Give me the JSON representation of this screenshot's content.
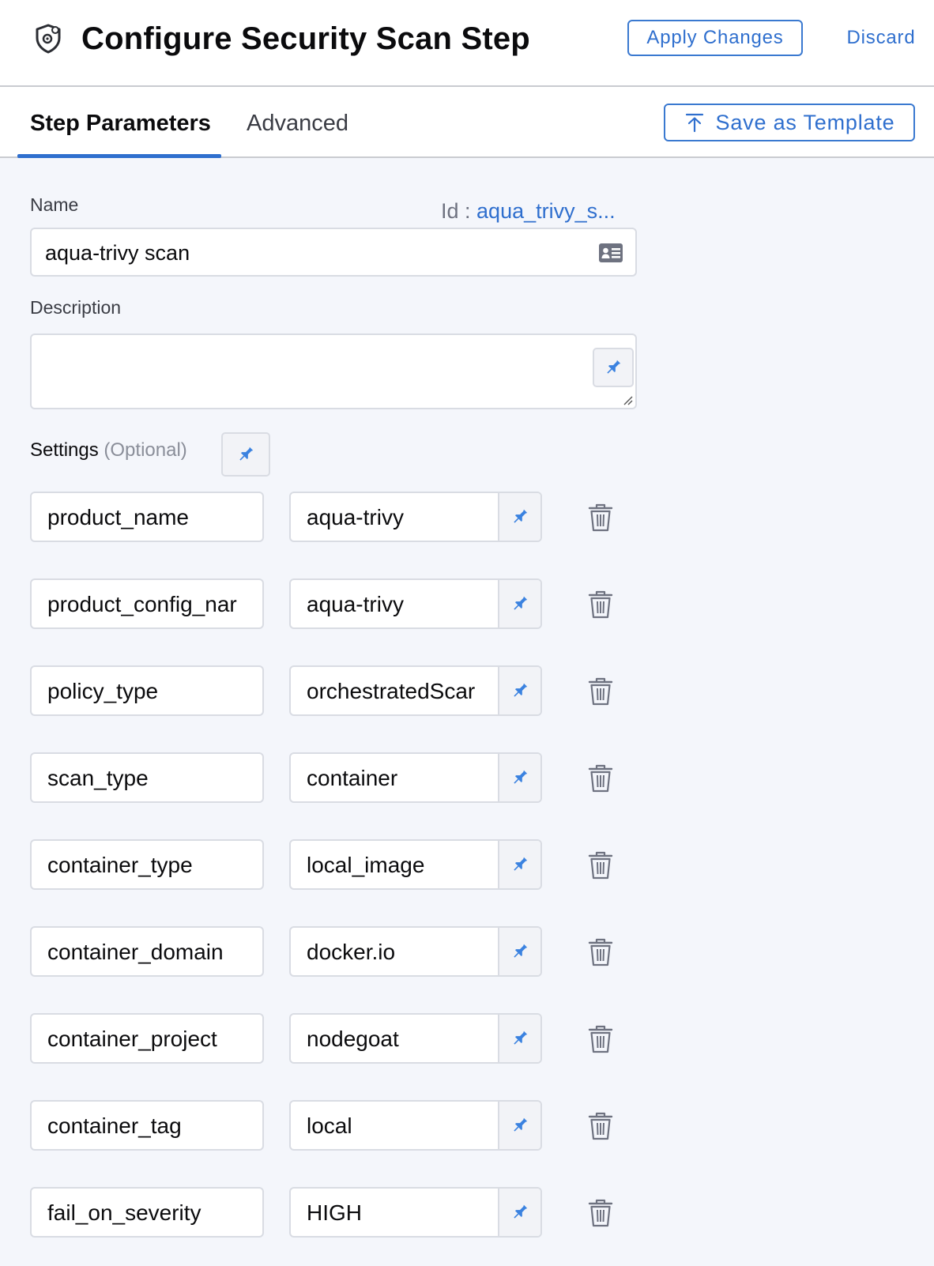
{
  "header": {
    "title": "Configure Security Scan Step",
    "icon": "shield-gear-icon",
    "apply_label": "Apply Changes",
    "discard_label": "Discard"
  },
  "tabs": [
    {
      "label": "Step Parameters",
      "active": true
    },
    {
      "label": "Advanced",
      "active": false
    }
  ],
  "save_template_label": "Save as Template",
  "form": {
    "name_label": "Name",
    "id_prefix": "Id : ",
    "id_value": "aqua_trivy_s...",
    "name_value": "aqua-trivy scan",
    "description_label": "Description",
    "description_value": "",
    "settings_label": "Settings",
    "settings_optional": "(Optional)"
  },
  "settings": [
    {
      "key": "product_name",
      "value": "aqua-trivy"
    },
    {
      "key": "product_config_nar",
      "value": "aqua-trivy"
    },
    {
      "key": "policy_type",
      "value": "orchestratedScar"
    },
    {
      "key": "scan_type",
      "value": "container"
    },
    {
      "key": "container_type",
      "value": "local_image"
    },
    {
      "key": "container_domain",
      "value": "docker.io"
    },
    {
      "key": "container_project",
      "value": "nodegoat"
    },
    {
      "key": "container_tag",
      "value": "local"
    },
    {
      "key": "fail_on_severity",
      "value": "HIGH"
    }
  ],
  "colors": {
    "accent": "#2f6fce",
    "pin": "#3b82e0",
    "content_bg": "#f4f6fb",
    "border": "#d9dce3"
  }
}
